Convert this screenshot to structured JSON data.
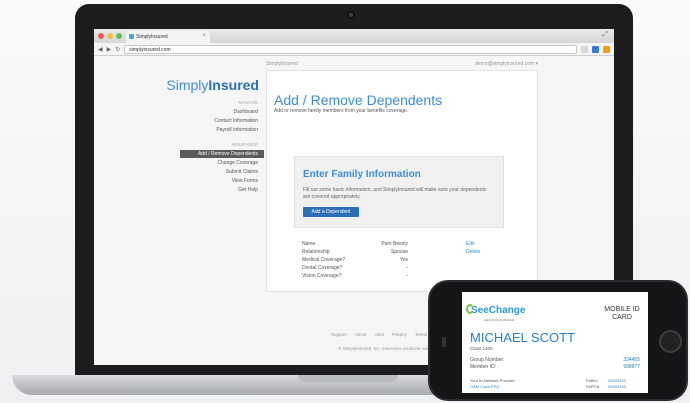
{
  "browser": {
    "tab_title": "SimplyInsured",
    "url": "simplyinsured.com",
    "tab_close": "×",
    "expand": "⤢"
  },
  "sidebar": {
    "logo_light": "Simply",
    "logo_bold": "Insured",
    "section_1": "MANAGE",
    "items_1": [
      "Dashboard",
      "Contact Information",
      "Payroll Information"
    ],
    "section_2": "INSURANCE",
    "items_2": [
      "Add / Remove Dependents",
      "Change Coverage",
      "Submit Claims",
      "View Forms",
      "Get Help"
    ]
  },
  "topbar": {
    "brand": "SimplyInsured",
    "account": "demo@simplyinsured.com ▾"
  },
  "main": {
    "title": "Add / Remove Dependents",
    "subtitle": "Add or remove family members from your benefits coverage."
  },
  "info_box": {
    "title": "Enter Family Information",
    "text": "Fill out some basic information, and SimplyInsured will make sure your dependents are covered appropriately.",
    "button": "Add a Dependent"
  },
  "dependent": {
    "rows": [
      {
        "label": "Name",
        "value": "Pam Beesly"
      },
      {
        "label": "Relationship",
        "value": "Spouse"
      },
      {
        "label": "Medical Coverage?",
        "value": "Yes"
      },
      {
        "label": "Dental Coverage?",
        "value": "-"
      },
      {
        "label": "Vision Coverage?",
        "value": "-"
      }
    ],
    "edit": "Edit",
    "delete": "Delete"
  },
  "footer": {
    "links": [
      "Support",
      "About",
      "Jobs",
      "Privacy",
      "Terms"
    ],
    "copyright": "© SimplyInsured, Inc. Insurance products sold"
  },
  "id_card": {
    "logo": "SeeChange",
    "tagline": "HEALTH INSURANCE",
    "mobile_id": "MOBILE ID CARD",
    "member_name": "MICHAEL SCOTT",
    "class": "Class 1400",
    "group_label": "Group Number:",
    "group_value": "334455",
    "member_label": "Member ID:",
    "member_value": "998877",
    "network_label": "Your In-Network Provider:",
    "network_value": "OAM Copa PPO",
    "rxbin_label": "RxBin:",
    "rxbin_value": "03333333",
    "rxpcn_label": "RxPCN:",
    "rxpcn_value": "03333333"
  },
  "colors": {
    "brand_blue": "#3b8ed6",
    "button_blue": "#2b6fb6",
    "active_nav": "#5b5b5b"
  }
}
